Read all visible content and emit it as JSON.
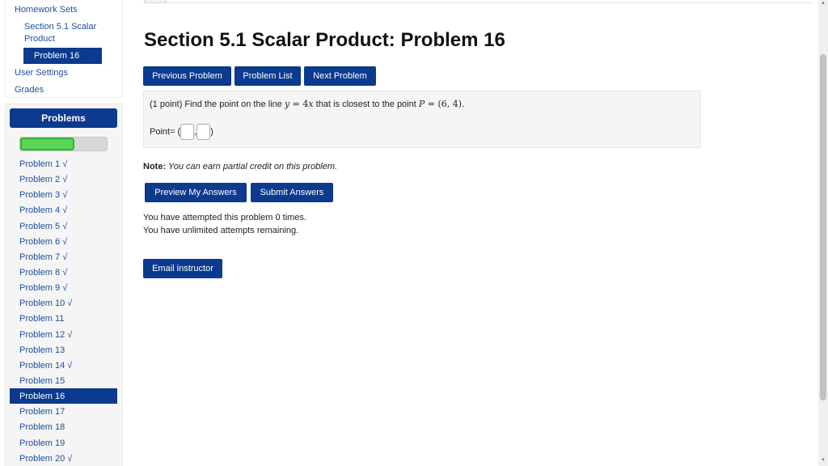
{
  "nav": {
    "homework_sets": "Homework Sets",
    "section_line1": "Section 5.1 Scalar",
    "section_line2": "Product",
    "current_problem": "Problem 16",
    "user_settings": "User Settings",
    "grades": "Grades"
  },
  "problems_panel": {
    "header": "Problems",
    "progress": 0.63,
    "items": [
      {
        "label": "Problem 1 √"
      },
      {
        "label": "Problem 2 √"
      },
      {
        "label": "Problem 3 √"
      },
      {
        "label": "Problem 4 √"
      },
      {
        "label": "Problem 5 √"
      },
      {
        "label": "Problem 6 √"
      },
      {
        "label": "Problem 7 √"
      },
      {
        "label": "Problem 8 √"
      },
      {
        "label": "Problem 9 √"
      },
      {
        "label": "Problem 10 √"
      },
      {
        "label": "Problem 11"
      },
      {
        "label": "Problem 12 √"
      },
      {
        "label": "Problem 13"
      },
      {
        "label": "Problem 14 √"
      },
      {
        "label": "Problem 15"
      },
      {
        "label": "Problem 16"
      },
      {
        "label": "Problem 17"
      },
      {
        "label": "Problem 18"
      },
      {
        "label": "Problem 19"
      },
      {
        "label": "Problem 20 √"
      }
    ]
  },
  "main": {
    "title": "Section 5.1 Scalar Product: Problem 16",
    "buttons": {
      "previous": "Previous Problem",
      "list": "Problem List",
      "next": "Next Problem",
      "preview": "Preview My Answers",
      "submit": "Submit Answers",
      "email": "Email instructor"
    },
    "problem": {
      "points": "(1 point) Find the point on the line ",
      "eq_lhs": "y",
      "eq_sign": " = 4",
      "eq_rhs": "x",
      "mid": " that is closest to the point ",
      "point_var": "P",
      "point_val": " = (6, 4).",
      "answer_label": "Point= (",
      "answer_sep": ",",
      "answer_close": ")",
      "input_x": "",
      "input_y": ""
    },
    "note_label": "Note:",
    "note_text": " You can earn partial credit on this problem.",
    "attempts": "You have attempted this problem 0 times.",
    "remaining": "You have unlimited attempts remaining."
  }
}
